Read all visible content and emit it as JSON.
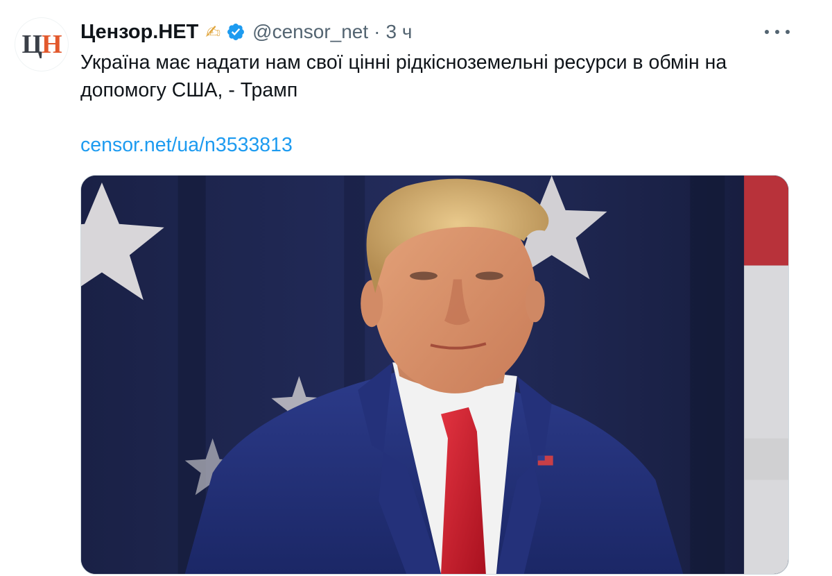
{
  "tweet": {
    "avatar": {
      "logo_letter_1": "Ц",
      "logo_letter_2": "Н"
    },
    "display_name": "Цензор.НЕТ",
    "name_emoji": "✍",
    "handle": "@censor_net",
    "separator": "·",
    "time": "3 ч",
    "text": "Україна має надати нам свої цінні рідкісноземельні ресурси в обмін на допомогу США, - Трамп",
    "link": "censor.net/ua/n3533813",
    "icons": {
      "verified": "verified-badge-icon",
      "more": "more-options-icon",
      "writing": "writing-hand-icon"
    },
    "colors": {
      "link": "#1d9bf0",
      "secondary_text": "#536471",
      "verified": "#1d9bf0",
      "logo_accent": "#e2592d"
    }
  }
}
